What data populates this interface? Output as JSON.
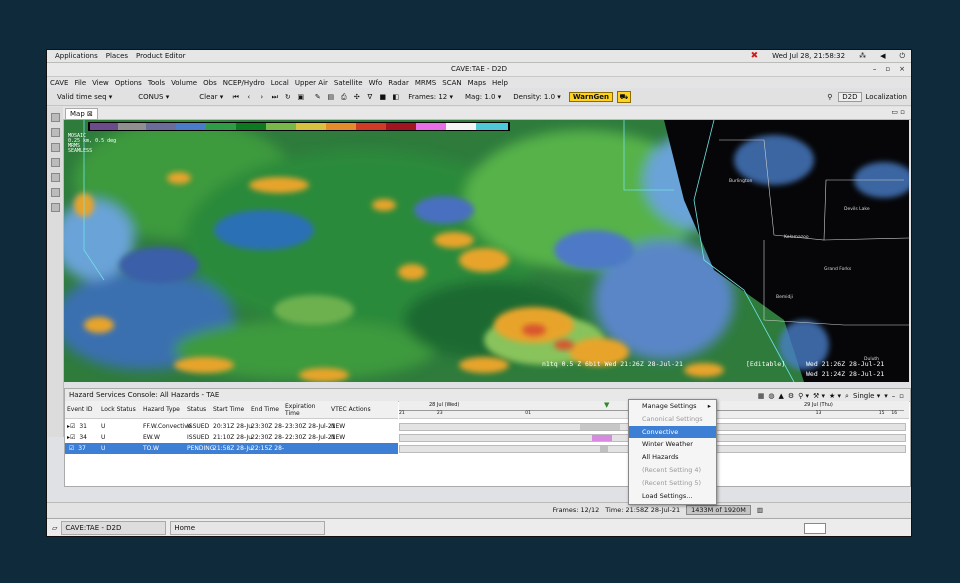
{
  "gnome_bar": {
    "applications": "Applications",
    "places": "Places",
    "product_editor": "Product Editor",
    "clock": "Wed Jul 28, 21:58:32"
  },
  "window": {
    "title": "CAVE:TAE - D2D"
  },
  "menubar": [
    "CAVE",
    "File",
    "View",
    "Options",
    "Tools",
    "Volume",
    "Obs",
    "NCEP/Hydro",
    "Local",
    "Upper Air",
    "Satellite",
    "Wfo",
    "Radar",
    "MRMS",
    "SCAN",
    "Maps",
    "Help"
  ],
  "toolbar": {
    "valid_time": "Valid time seq",
    "scale": "CONUS",
    "clear": "Clear",
    "frames": "Frames: 12",
    "mag": "Mag: 1.0",
    "density": "Density: 1.0",
    "warngen": "WarnGen",
    "localization": "Localization",
    "d2d": "D2D"
  },
  "map": {
    "tab_label": "Map",
    "readout": [
      "MOSAIC",
      "0.25 km, 0.5 deg",
      "MRMS",
      "SEAMLESS"
    ],
    "time_label": "Wed 21:26Z 28-Jul-21",
    "time_label2": "Wed 21:24Z 28-Jul-21",
    "editable_label": "[Editable]",
    "bottom_left_label": "n1tq 0.5  Z 6bit  Wed 21:26Z 28-Jul-21"
  },
  "hazard": {
    "title": "Hazard Services Console: All Hazards - TAE",
    "columns": [
      "Event ID",
      "Lock Status",
      "Hazard Type",
      "Status",
      "Start Time",
      "End Time",
      "Expiration Time",
      "VTEC Actions"
    ],
    "rows": [
      {
        "id": "31",
        "lock": "U",
        "type": "FF.W.Convective",
        "status": "ISSUED",
        "start": "20:31Z 28-Ju",
        "end": "23:30Z 28-",
        "exp": "23:30Z 28-Jul-21",
        "vtec": "NEW",
        "selected": false
      },
      {
        "id": "34",
        "lock": "U",
        "type": "EW.W",
        "status": "ISSUED",
        "start": "21:10Z 28-Ju",
        "end": "22:30Z 28-",
        "exp": "22:30Z 28-Jul-21",
        "vtec": "NEW",
        "selected": false
      },
      {
        "id": "37",
        "lock": "U",
        "type": "TO.W",
        "status": "PENDING",
        "start": "21:58Z 28-Ju",
        "end": "22:15Z 28-",
        "exp": "",
        "vtec": "",
        "selected": true
      }
    ],
    "timeline_day1": "28 Jul (Wed)",
    "timeline_day2": "29 Jul (Thu)",
    "single_label": "Single",
    "tl_hours": [
      "21",
      "",
      "",
      "23",
      "",
      "",
      "",
      "",
      "",
      "",
      "01",
      "",
      "",
      "",
      "",
      "",
      "",
      "",
      "",
      "",
      "",
      "",
      "",
      "07",
      "",
      "",
      "",
      "",
      "",
      "",
      "",
      "",
      "",
      "13",
      "",
      "",
      "",
      "",
      "15",
      "16"
    ]
  },
  "context_menu": [
    {
      "label": "Manage Settings",
      "disabled": false,
      "highlight": false,
      "sub": true
    },
    {
      "label": "Canonical Settings",
      "disabled": true,
      "highlight": false,
      "sub": false
    },
    {
      "label": "Convective",
      "disabled": false,
      "highlight": true,
      "sub": false
    },
    {
      "label": "Winter Weather",
      "disabled": false,
      "highlight": false,
      "sub": false
    },
    {
      "label": "All Hazards",
      "disabled": false,
      "highlight": false,
      "sub": false
    },
    {
      "label": "(Recent Setting 4)",
      "disabled": true,
      "highlight": false,
      "sub": false
    },
    {
      "label": "(Recent Setting 5)",
      "disabled": true,
      "highlight": false,
      "sub": false
    },
    {
      "label": "Load Settings...",
      "disabled": false,
      "highlight": false,
      "sub": false
    }
  ],
  "status_bar": {
    "frames": "Frames: 12/12",
    "time": "Time: 21:58Z 28-Jul-21",
    "memory": "1433M of 1920M"
  },
  "taskbar": {
    "task1": "CAVE:TAE - D2D",
    "task2": "Home"
  },
  "colors": {
    "selection": "#3d7fd4",
    "warngen": "#ffd21f",
    "screen_bg": "#0f2a3a"
  }
}
